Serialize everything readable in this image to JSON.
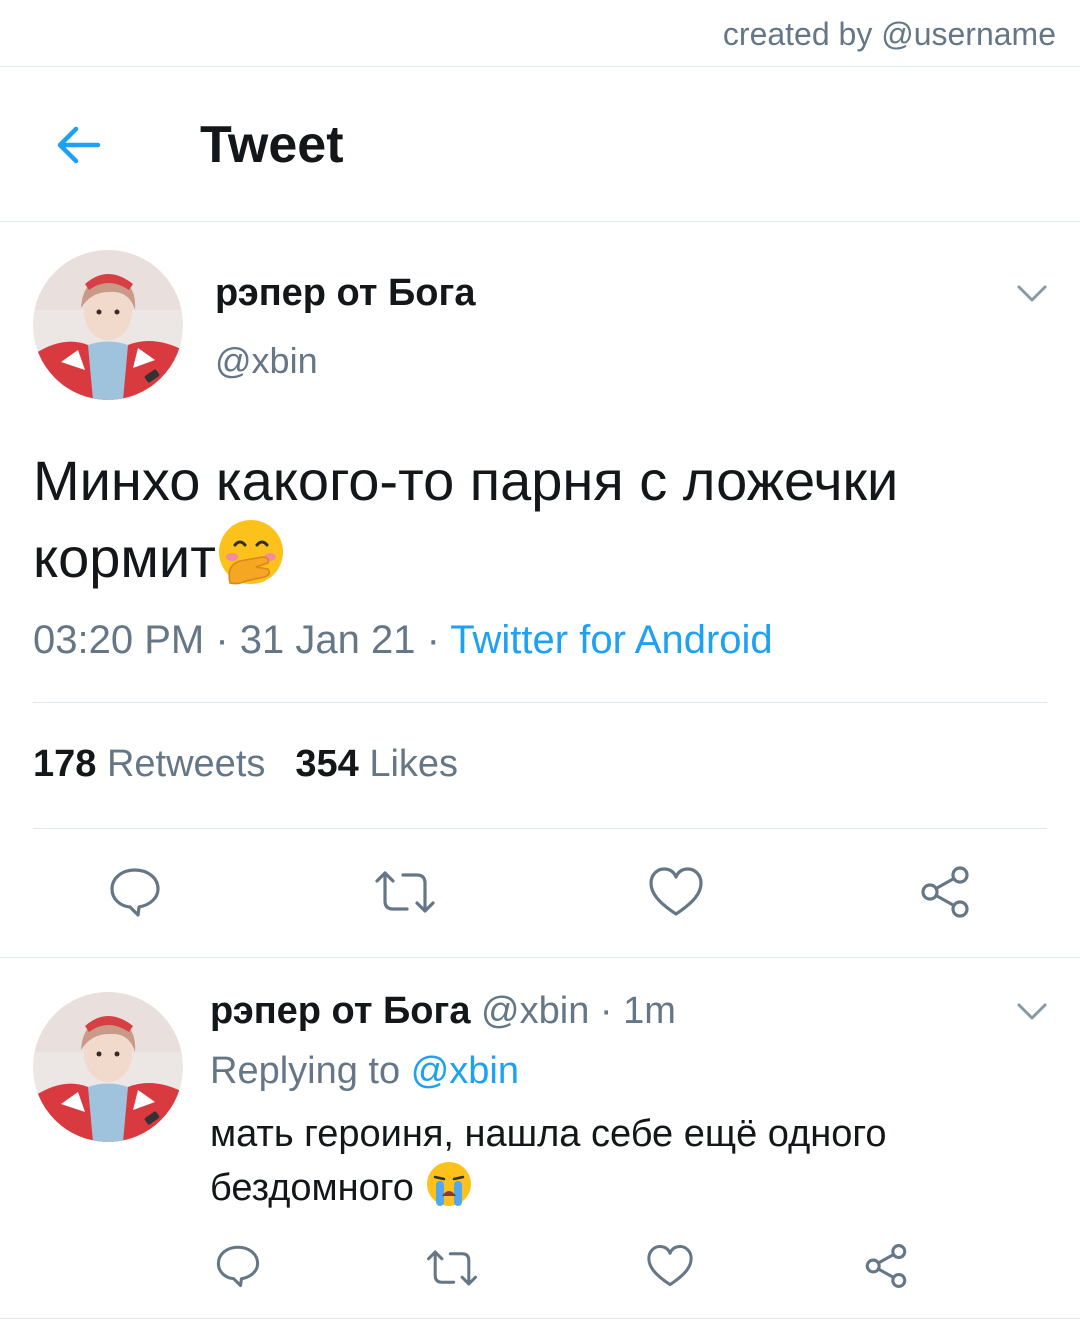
{
  "credit": "created by @username",
  "header": {
    "title": "Tweet"
  },
  "tweet": {
    "author_name": "рэпер от Бога",
    "author_handle": "@xbin",
    "text": "Минхо какого-то парня с ложечки кормит",
    "text_emoji": "face-with-hand-over-mouth",
    "time": "03:20 PM",
    "date": "31 Jan 21",
    "separator": " · ",
    "source": "Twitter for Android",
    "retweets_count": "178",
    "retweets_label": "Retweets",
    "likes_count": "354",
    "likes_label": "Likes"
  },
  "reply": {
    "author_name": "рэпер от Бога",
    "author_handle": "@xbin",
    "age": "1m",
    "separator": " · ",
    "replying_prefix": "Replying to",
    "replying_handle": "@xbin",
    "text": "мать героиня, нашла себе ещё одного бездомного",
    "text_emoji": "loudly-crying-face"
  },
  "colors": {
    "accent": "#1da1f2",
    "secondary_text": "#657786",
    "primary_text": "#14171a",
    "divider": "#e1e8ed"
  }
}
